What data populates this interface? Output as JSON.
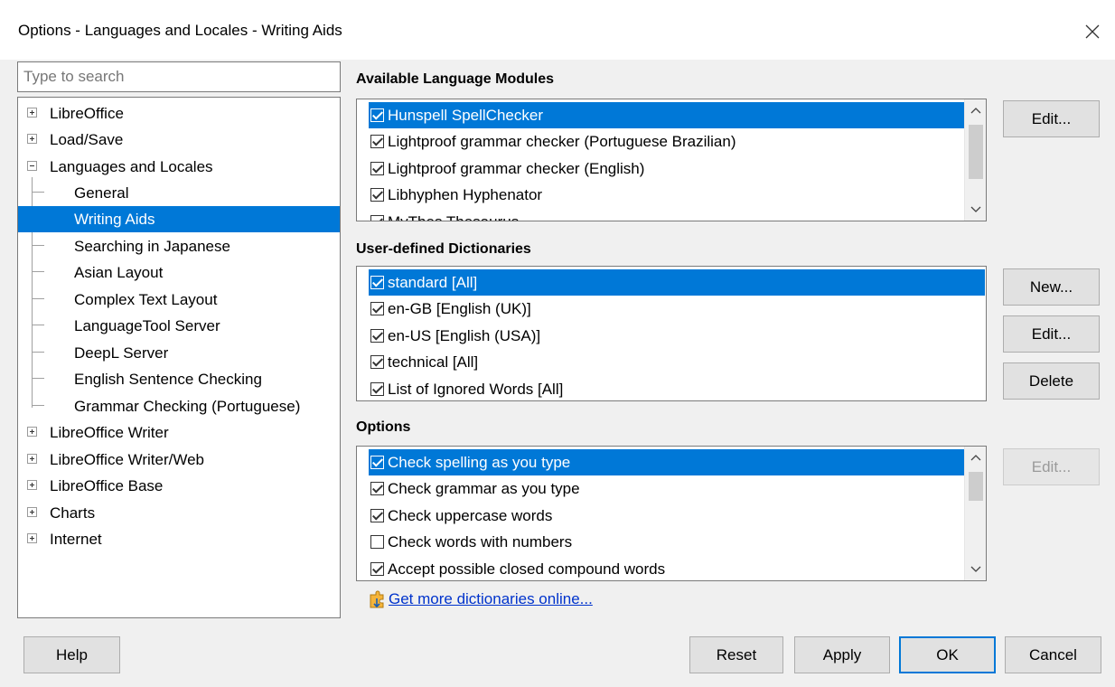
{
  "window": {
    "title": "Options - Languages and Locales - Writing Aids"
  },
  "search": {
    "placeholder": "Type to search"
  },
  "tree": {
    "items": [
      {
        "label": "LibreOffice",
        "level": 0,
        "expander": "plus"
      },
      {
        "label": "Load/Save",
        "level": 0,
        "expander": "plus"
      },
      {
        "label": "Languages and Locales",
        "level": 0,
        "expander": "minus"
      },
      {
        "label": "General",
        "level": 1
      },
      {
        "label": "Writing Aids",
        "level": 1,
        "selected": true
      },
      {
        "label": "Searching in Japanese",
        "level": 1
      },
      {
        "label": "Asian Layout",
        "level": 1
      },
      {
        "label": "Complex Text Layout",
        "level": 1
      },
      {
        "label": "LanguageTool Server",
        "level": 1
      },
      {
        "label": "DeepL Server",
        "level": 1
      },
      {
        "label": "English Sentence Checking",
        "level": 1
      },
      {
        "label": "Grammar Checking (Portuguese)",
        "level": 1
      },
      {
        "label": "LibreOffice Writer",
        "level": 0,
        "expander": "plus"
      },
      {
        "label": "LibreOffice Writer/Web",
        "level": 0,
        "expander": "plus"
      },
      {
        "label": "LibreOffice Base",
        "level": 0,
        "expander": "plus"
      },
      {
        "label": "Charts",
        "level": 0,
        "expander": "plus"
      },
      {
        "label": "Internet",
        "level": 0,
        "expander": "plus"
      }
    ]
  },
  "modules": {
    "title": "Available Language Modules",
    "items": [
      {
        "label": "Hunspell SpellChecker",
        "checked": true,
        "selected": true
      },
      {
        "label": "Lightproof grammar checker (Portuguese Brazilian)",
        "checked": true
      },
      {
        "label": "Lightproof grammar checker (English)",
        "checked": true
      },
      {
        "label": "Libhyphen Hyphenator",
        "checked": true
      },
      {
        "label": "MyThes Thesaurus",
        "checked": true
      }
    ],
    "edit_label": "Edit..."
  },
  "dictionaries": {
    "title": "User-defined Dictionaries",
    "items": [
      {
        "label": "standard [All]",
        "checked": true,
        "selected": true
      },
      {
        "label": "en-GB [English (UK)]",
        "checked": true
      },
      {
        "label": "en-US [English (USA)]",
        "checked": true
      },
      {
        "label": "technical [All]",
        "checked": true
      },
      {
        "label": "List of Ignored Words [All]",
        "checked": true
      }
    ],
    "new_label": "New...",
    "edit_label": "Edit...",
    "delete_label": "Delete"
  },
  "options": {
    "title": "Options",
    "items": [
      {
        "label": "Check spelling as you type",
        "checked": true,
        "selected": true
      },
      {
        "label": "Check grammar as you type",
        "checked": true
      },
      {
        "label": "Check uppercase words",
        "checked": true
      },
      {
        "label": "Check words with numbers",
        "checked": false
      },
      {
        "label": "Accept possible closed compound words",
        "checked": true
      }
    ],
    "edit_label": "Edit..."
  },
  "link": {
    "label": "Get more dictionaries online..."
  },
  "footer": {
    "help_label": "Help",
    "reset_label": "Reset",
    "apply_label": "Apply",
    "ok_label": "OK",
    "cancel_label": "Cancel"
  },
  "colors": {
    "selection": "#0078d7",
    "link": "#0033cc"
  }
}
